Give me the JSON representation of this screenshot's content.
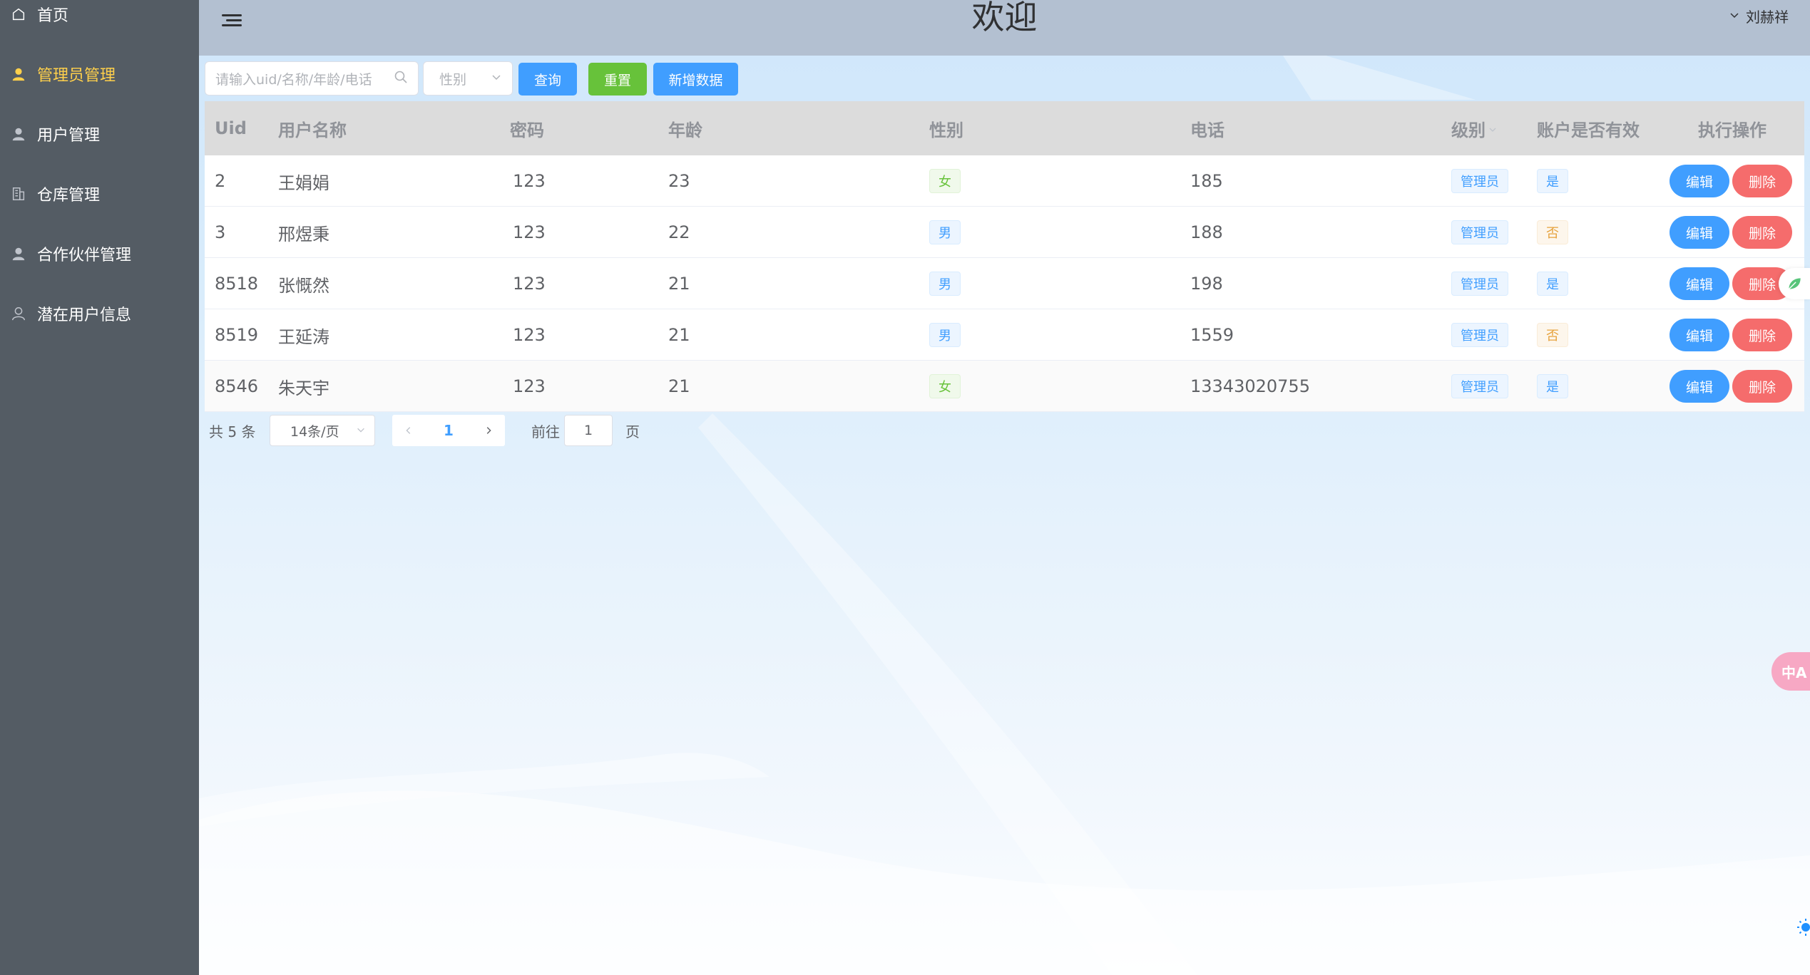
{
  "sidebar": {
    "items": [
      {
        "label": "首页",
        "icon": "home-icon",
        "active": false
      },
      {
        "label": "管理员管理",
        "icon": "user-icon",
        "active": true
      },
      {
        "label": "用户管理",
        "icon": "user-icon",
        "active": false
      },
      {
        "label": "仓库管理",
        "icon": "building-icon",
        "active": false
      },
      {
        "label": "合作伙伴管理",
        "icon": "user-icon",
        "active": false
      },
      {
        "label": "潜在用户信息",
        "icon": "user-outline-icon",
        "active": false
      }
    ]
  },
  "header": {
    "title": "欢迎",
    "user_name": "刘赫祥"
  },
  "toolbar": {
    "search_placeholder": "请输入uid/名称/年龄/电话",
    "gender_placeholder": "性别",
    "query_label": "查询",
    "reset_label": "重置",
    "add_label": "新增数据"
  },
  "table": {
    "columns": [
      "Uid",
      "用户名称",
      "密码",
      "年龄",
      "性别",
      "电话",
      "级别",
      "账户是否有效",
      "执行操作"
    ],
    "rows": [
      {
        "uid": "2",
        "name": "王娟娟",
        "password": "123",
        "age": "23",
        "gender": "女",
        "phone": "185",
        "level": "管理员",
        "valid": "是"
      },
      {
        "uid": "3",
        "name": "邢煜秉",
        "password": "123",
        "age": "22",
        "gender": "男",
        "phone": "188",
        "level": "管理员",
        "valid": "否"
      },
      {
        "uid": "8518",
        "name": "张慨然",
        "password": "123",
        "age": "21",
        "gender": "男",
        "phone": "198",
        "level": "管理员",
        "valid": "是"
      },
      {
        "uid": "8519",
        "name": "王延涛",
        "password": "123",
        "age": "21",
        "gender": "男",
        "phone": "1559",
        "level": "管理员",
        "valid": "否"
      },
      {
        "uid": "8546",
        "name": "朱天宇",
        "password": "123",
        "age": "21",
        "gender": "女",
        "phone": "13343020755",
        "level": "管理员",
        "valid": "是"
      }
    ],
    "edit_label": "编辑",
    "delete_label": "删除"
  },
  "pagination": {
    "total_text": "共 5 条",
    "page_size": "14条/页",
    "current_page": "1",
    "goto_label": "前往",
    "goto_value": "1",
    "page_suffix": "页"
  },
  "floating": {
    "translate_label": "中A"
  },
  "colors": {
    "sidebar_bg": "#545c64",
    "active_menu": "#ffd04b",
    "header_bg": "#b3c0d1",
    "primary": "#409eff",
    "success": "#67c23a",
    "danger": "#f56c6c",
    "warning": "#e6a23c"
  }
}
